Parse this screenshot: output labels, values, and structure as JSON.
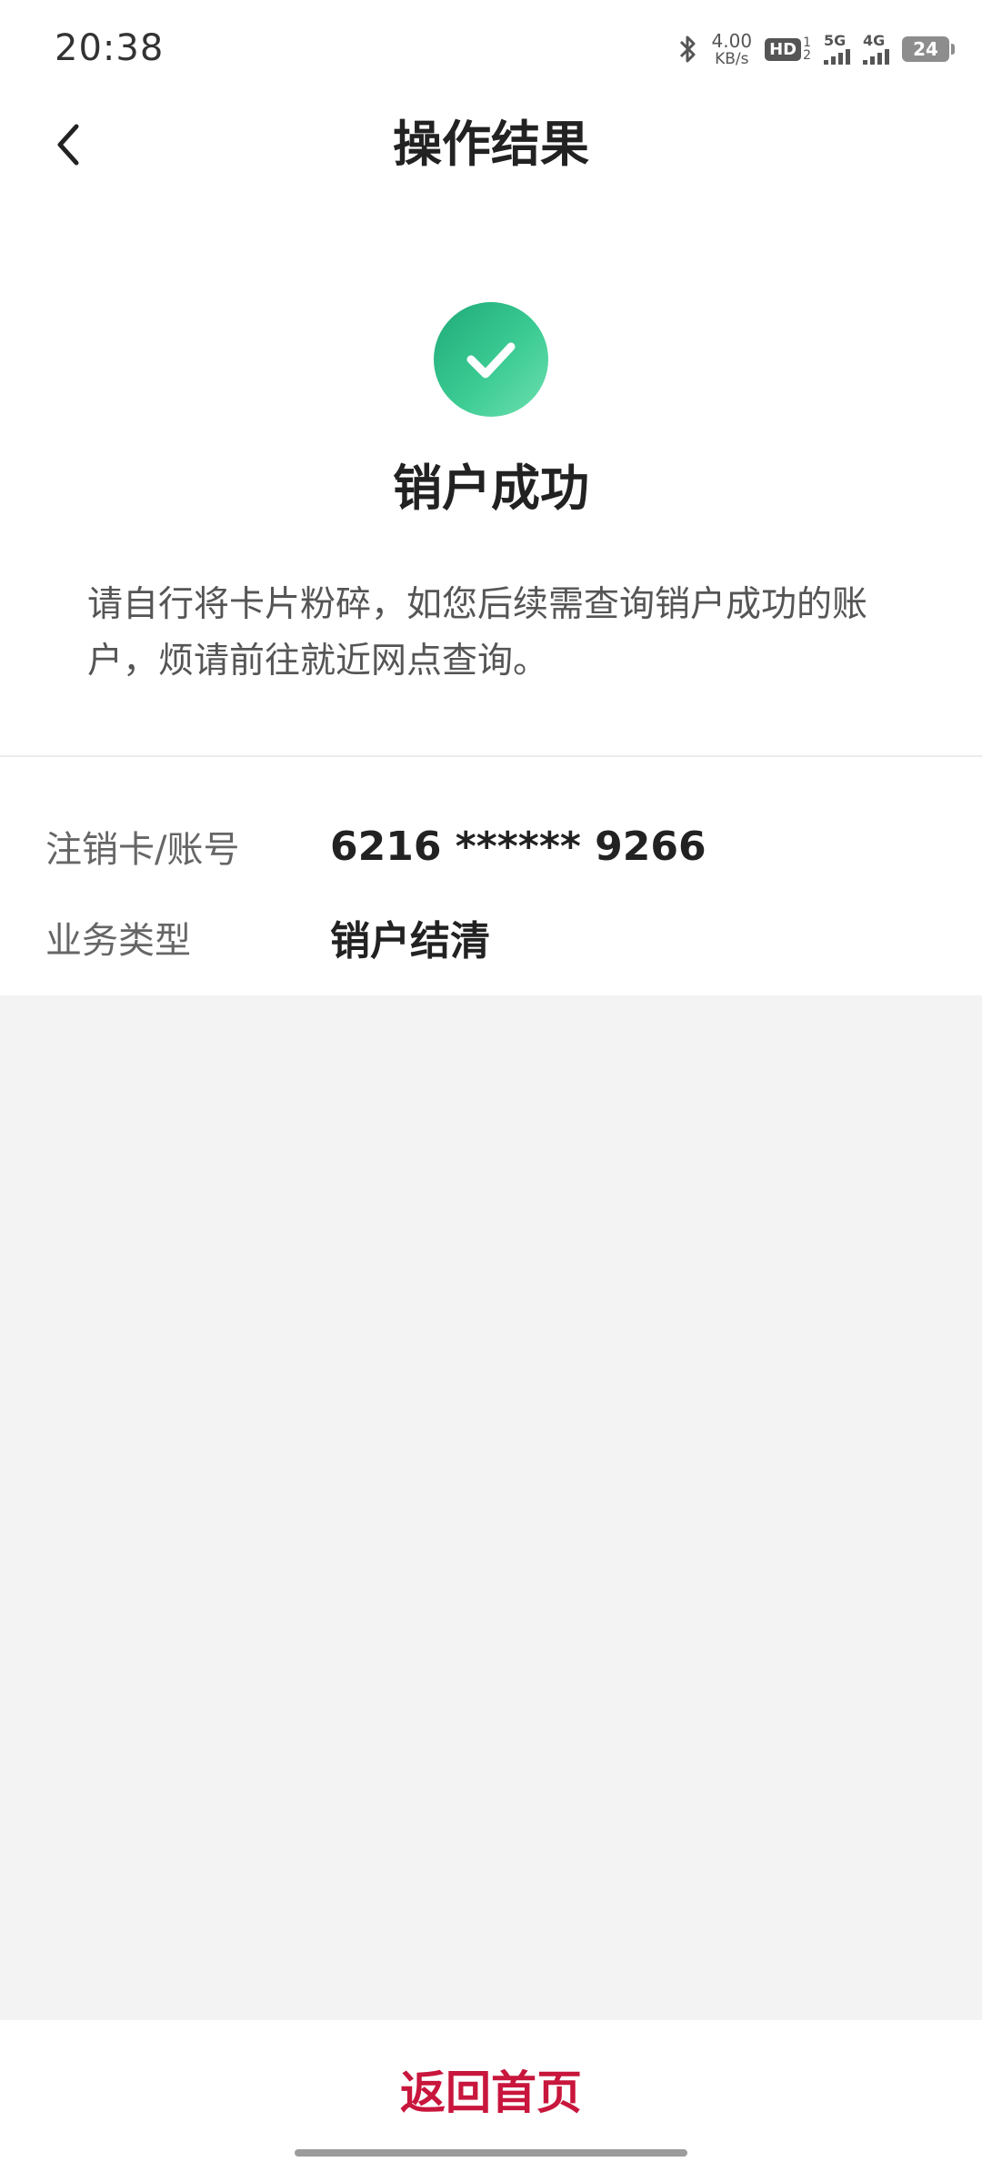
{
  "status_bar": {
    "time": "20:38",
    "net_speed_value": "4.00",
    "net_speed_unit": "KB/s",
    "hd_label": "HD",
    "hd_sub_top": "1",
    "hd_sub_bottom": "2",
    "signal1_label": "5G",
    "signal2_label": "4G",
    "battery": "24"
  },
  "nav": {
    "title": "操作结果"
  },
  "result": {
    "title": "销户成功",
    "description": "请自行将卡片粉碎，如您后续需查询销户成功的账户，烦请前往就近网点查询。",
    "icon": "check-circle-icon",
    "accent_color": "#2cbf86"
  },
  "info": [
    {
      "label": "注销卡/账号",
      "value": "6216 ****** 9266"
    },
    {
      "label": "业务类型",
      "value": "销户结清"
    }
  ],
  "bottom": {
    "home_button_label": "返回首页",
    "button_color": "#c8163c"
  }
}
